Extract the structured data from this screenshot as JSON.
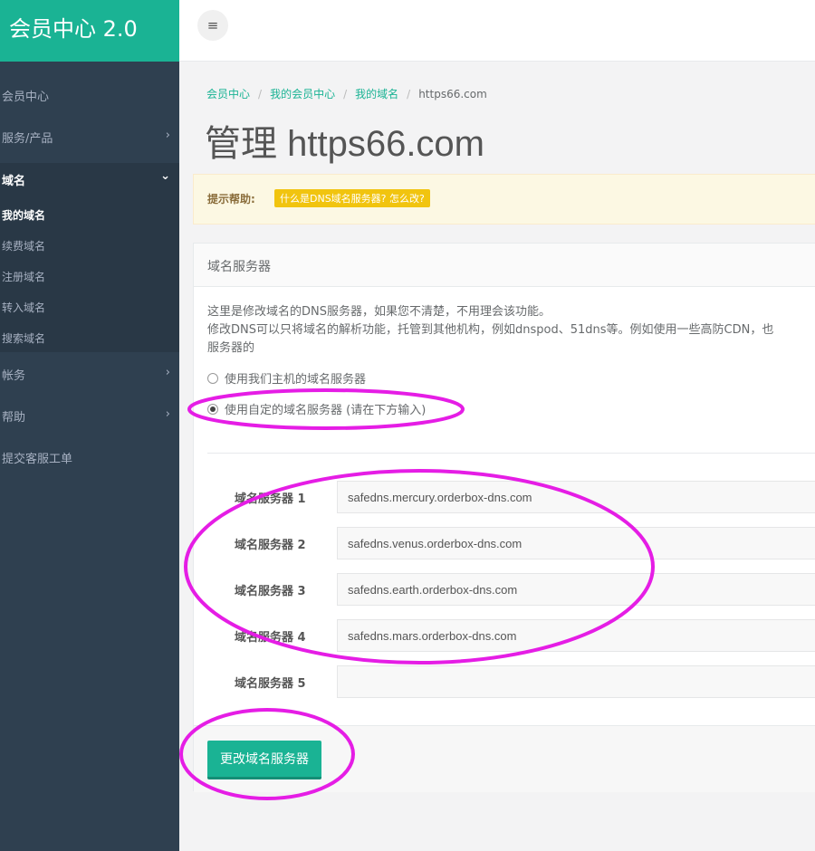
{
  "brand": {
    "title": "会员中心 2.0"
  },
  "sidebar": {
    "items": [
      {
        "label": "会员中心",
        "chevron": ""
      },
      {
        "label": "服务/产品",
        "chevron": "›"
      },
      {
        "label": "域名",
        "chevron": "⌄"
      },
      {
        "label": "帐务",
        "chevron": "›"
      },
      {
        "label": "帮助",
        "chevron": "›"
      },
      {
        "label": "提交客服工单",
        "chevron": ""
      }
    ],
    "sub_items": [
      "我的域名",
      "续费域名",
      "注册域名",
      "转入域名",
      "搜索域名"
    ]
  },
  "topbar": {
    "menu_icon": "≡"
  },
  "breadcrumb": [
    "会员中心",
    "我的会员中心",
    "我的域名",
    "https66.com"
  ],
  "page_title": "管理 https66.com",
  "alert": {
    "label": "提示帮助:",
    "badge": "什么是DNS域名服务器? 怎么改?"
  },
  "panel": {
    "heading": "域名服务器",
    "description": [
      "这里是修改域名的DNS服务器，如果您不清楚，不用理会该功能。",
      "修改DNS可以只将域名的解析功能，托管到其他机构，例如dnspod、51dns等。例如使用一些高防CDN，也",
      "服务器的"
    ],
    "radio_default": "使用我们主机的域名服务器",
    "radio_custom": "使用自定的域名服务器 (请在下方输入)",
    "selected": "custom",
    "fields": [
      {
        "label": "域名服务器 1",
        "value": "safedns.mercury.orderbox-dns.com"
      },
      {
        "label": "域名服务器 2",
        "value": "safedns.venus.orderbox-dns.com"
      },
      {
        "label": "域名服务器 3",
        "value": "safedns.earth.orderbox-dns.com"
      },
      {
        "label": "域名服务器 4",
        "value": "safedns.mars.orderbox-dns.com"
      },
      {
        "label": "域名服务器 5",
        "value": ""
      }
    ],
    "submit_label": "更改域名服务器"
  },
  "colors": {
    "accent": "#1ab394",
    "sidebar": "#2f4050",
    "annotation": "#e51de5"
  }
}
